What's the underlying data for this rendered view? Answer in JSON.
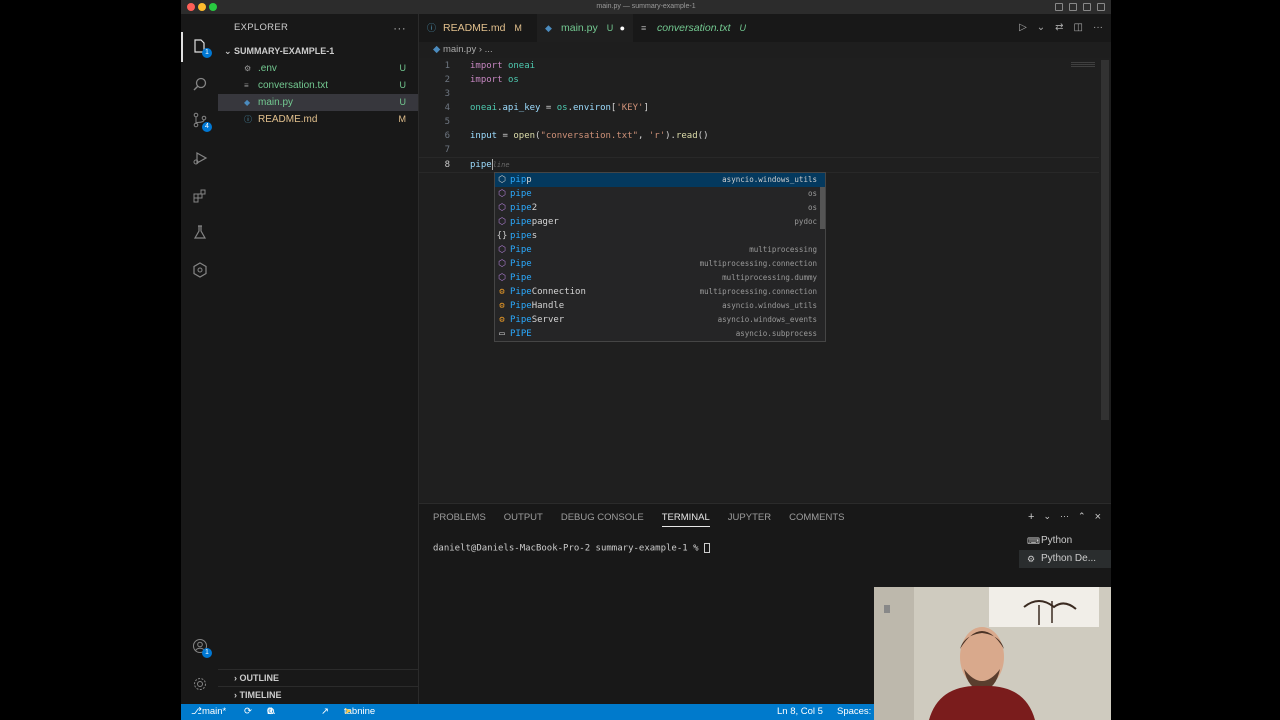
{
  "window": {
    "title": "main.py — summary-example-1"
  },
  "activity_bar": {
    "source_control_badge": "4",
    "accounts_badge": "1",
    "explorer_badge": "1"
  },
  "explorer": {
    "title": "EXPLORER",
    "folder": "SUMMARY-EXAMPLE-1",
    "files": [
      {
        "name": ".env",
        "status": "U"
      },
      {
        "name": "conversation.txt",
        "status": "U"
      },
      {
        "name": "main.py",
        "status": "U"
      },
      {
        "name": "README.md",
        "status": "M"
      }
    ],
    "outline": "OUTLINE",
    "timeline": "TIMELINE"
  },
  "tabs": [
    {
      "label": "README.md",
      "flag": "M"
    },
    {
      "label": "main.py",
      "flag": "U"
    },
    {
      "label": "conversation.txt",
      "flag": "U"
    }
  ],
  "breadcrumb": {
    "file": "main.py",
    "more": "..."
  },
  "editor": {
    "line_numbers": [
      "1",
      "2",
      "3",
      "4",
      "5",
      "6",
      "7",
      "8"
    ],
    "lines": [
      "import oneai",
      "import os",
      "",
      "oneai.api_key = os.environ['KEY']",
      "",
      "input = open(\"conversation.txt\", 'r').read()",
      "",
      "pipe"
    ],
    "ghost_text": "line"
  },
  "suggestions": [
    {
      "icon": "module",
      "match": "pip",
      "rest": "p",
      "detail": "asyncio.windows_utils"
    },
    {
      "icon": "module",
      "match": "pipe",
      "rest": "",
      "detail": "os"
    },
    {
      "icon": "module",
      "match": "pipe",
      "rest": "2",
      "detail": "os"
    },
    {
      "icon": "module",
      "match": "pipe",
      "rest": "pager",
      "detail": "pydoc"
    },
    {
      "icon": "braces",
      "match": "pipe",
      "rest": "s",
      "detail": ""
    },
    {
      "icon": "module",
      "match": "Pipe",
      "rest": "",
      "detail": "multiprocessing"
    },
    {
      "icon": "module",
      "match": "Pipe",
      "rest": "",
      "detail": "multiprocessing.connection"
    },
    {
      "icon": "module",
      "match": "Pipe",
      "rest": "",
      "detail": "multiprocessing.dummy"
    },
    {
      "icon": "class",
      "match": "Pipe",
      "rest": "Connection",
      "detail": "multiprocessing.connection"
    },
    {
      "icon": "class",
      "match": "Pipe",
      "rest": "Handle",
      "detail": "asyncio.windows_utils"
    },
    {
      "icon": "class",
      "match": "Pipe",
      "rest": "Server",
      "detail": "asyncio.windows_events"
    },
    {
      "icon": "constant",
      "match": "PIPE",
      "rest": "",
      "detail": "asyncio.subprocess"
    }
  ],
  "panel": {
    "tabs": [
      "PROBLEMS",
      "OUTPUT",
      "DEBUG CONSOLE",
      "TERMINAL",
      "JUPYTER",
      "COMMENTS"
    ],
    "active_tab": "TERMINAL",
    "prompt": "danielt@Daniels-MacBook-Pro-2 summary-example-1 %",
    "terminals": [
      "Python",
      "Python De..."
    ]
  },
  "statusbar": {
    "branch": "main*",
    "errors": "0",
    "warnings": "0",
    "tabnine": "tabnine starter",
    "position": "Ln 8, Col 5",
    "spaces": "Spaces:"
  }
}
